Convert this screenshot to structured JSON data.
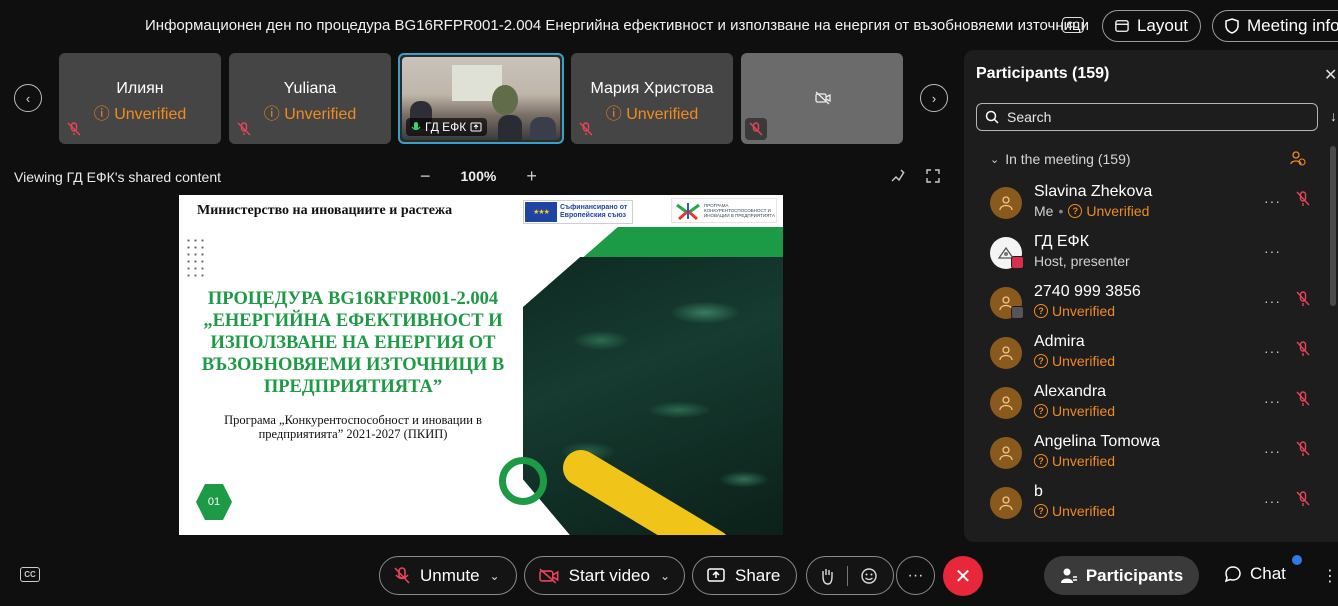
{
  "meeting": {
    "title": "Информационен ден по процедура BG16RFPR001-2.004 Енергийна ефективност и използване на енергия от възобновяеми източници",
    "cc_label": "CC",
    "layout_label": "Layout",
    "info_label": "Meeting info"
  },
  "filmstrip": {
    "prev_icon": "‹",
    "next_icon": "›",
    "tiles": [
      {
        "name": "Илиян",
        "status": "Unverified"
      },
      {
        "name": "Yuliana",
        "status": "Unverified"
      },
      {
        "name": "ГД ЕФК",
        "status": ""
      },
      {
        "name": "Мария Христова",
        "status": "Unverified"
      },
      {
        "name": "",
        "status": ""
      }
    ]
  },
  "share": {
    "caption": "Viewing ГД ЕФК's shared content",
    "zoom": "100%",
    "zoom_out": "−",
    "zoom_in": "+"
  },
  "slide": {
    "ministry": "Министерство на иновациите и растежа",
    "eu_text_line1": "Съфинансирано от",
    "eu_text_line2": "Европейския съюз",
    "pkip_line1": "ПРОГРАМА",
    "pkip_line2": "КОНКУРЕНТОСПОСОБНОСТ И",
    "pkip_line3": "ИНОВАЦИИ В ПРЕДПРИЯТИЯТА",
    "title": "ПРОЦЕДУРА BG16RFPR001-2.004 „ЕНЕРГИЙНА ЕФЕКТИВНОСТ И ИЗПОЛЗВАНЕ НА ЕНЕРГИЯ ОТ ВЪЗОБНОВЯЕМИ ИЗТОЧНИЦИ В ПРЕДПРИЯТИЯТА”",
    "subtitle": "Програма „Конкурентоспособност и иновации в предприятията” 2021-2027 (ПКИП)",
    "page_badge": "01"
  },
  "participants": {
    "title": "Participants (159)",
    "close": "✕",
    "search_placeholder": "Search",
    "section": "In the meeting (159)",
    "list": [
      {
        "name": "Slavina Zhekova",
        "role": "Me",
        "status": "Unverified"
      },
      {
        "name": "ГД ЕФК",
        "role": "Host, presenter",
        "status": ""
      },
      {
        "name": "2740 999 3856",
        "role": "",
        "status": "Unverified"
      },
      {
        "name": "Admira",
        "role": "",
        "status": "Unverified"
      },
      {
        "name": "Alexandra",
        "role": "",
        "status": "Unverified"
      },
      {
        "name": "Angelina Tomowa",
        "role": "",
        "status": "Unverified"
      },
      {
        "name": "b",
        "role": "",
        "status": "Unverified"
      }
    ],
    "more_label": "···"
  },
  "controls": {
    "cc": "CC",
    "unmute": "Unmute",
    "start_video": "Start video",
    "share": "Share",
    "more": "···",
    "leave": "✕",
    "participants": "Participants",
    "chat": "Chat",
    "overflow": "⋮"
  },
  "colors": {
    "warning": "#f08c1e",
    "accent_green": "#1d9a45",
    "leave_red": "#e8283a",
    "active_border": "#3aa0c4"
  }
}
